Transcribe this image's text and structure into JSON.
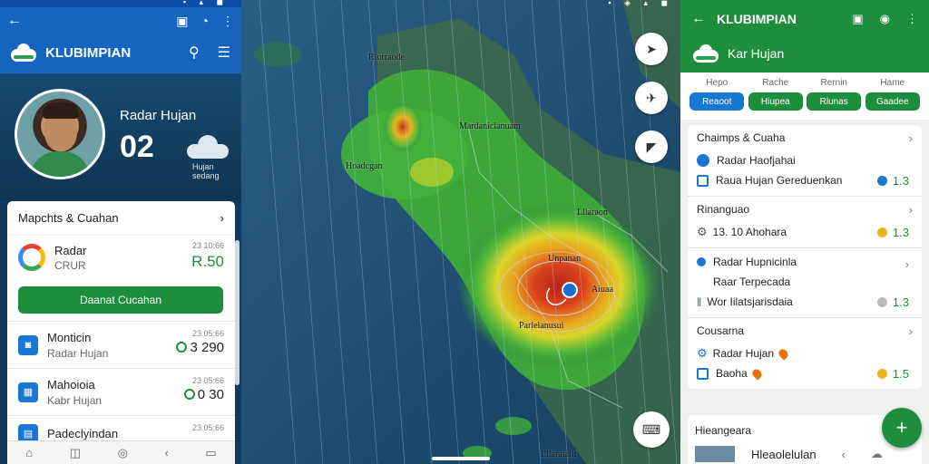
{
  "left": {
    "appbar_title": "KLUBIMPIAN",
    "hero": {
      "title": "Radar Hujan",
      "temperature": "02",
      "caption": "Hujan sedang"
    },
    "card": {
      "header": "Mapchts & Cuahan",
      "google_item": {
        "title": "Radar",
        "subtitle": "CRUR",
        "right_top": "23 10:66",
        "right_value": "R.50"
      },
      "button_label": "Daanat Cucahan",
      "list": [
        {
          "title": "Monticin",
          "subtitle": "Radar Hujan",
          "right_top": "23 05:66",
          "right_value": "3 290"
        },
        {
          "title": "Mahoioia",
          "subtitle": "Kabr Hujan",
          "right_top": "23 05:66",
          "right_value": "0 30"
        },
        {
          "title": "Padeclyindan",
          "subtitle": "",
          "right_top": "23 05:66",
          "right_value": ""
        }
      ]
    }
  },
  "map": {
    "labels": [
      "Rlorraode",
      "Mardaniclanuam",
      "Hoadcgan",
      "Lllaraon",
      "Unpanan",
      "Aiuaa",
      "Parlelanusui",
      "Lllaraiatlt"
    ]
  },
  "right": {
    "appbar_title": "KLUBIMPIAN",
    "subtitle": "Kar Hujan",
    "tabs": [
      {
        "label": "Hepo",
        "pill": "Reaoot",
        "active": true
      },
      {
        "label": "Rache",
        "pill": "Hiupea",
        "active": false
      },
      {
        "label": "Rernin",
        "pill": "Rlunas",
        "active": false
      },
      {
        "label": "Hame",
        "pill": "Gaadee",
        "active": false
      }
    ],
    "sections": [
      {
        "header": "Chaimps & Cuaha",
        "items": [
          {
            "icon": "pin",
            "text": "Radar Haofjahai",
            "value": ""
          },
          {
            "icon": "square",
            "text": "Raua Hujan Gereduenkan",
            "value": "1.3"
          }
        ]
      },
      {
        "header": "Rinanguao",
        "items": [
          {
            "icon": "gear",
            "text": "13. 10 Ahohara",
            "value": "1.3"
          }
        ]
      },
      {
        "header": "",
        "items": [
          {
            "icon": "pin",
            "text": "Radar Hupnicinla",
            "value": ""
          },
          {
            "icon": "none",
            "text": "Raar Terpecada",
            "value": ""
          },
          {
            "icon": "bars",
            "text": "Wor Iilatsjarisdaia",
            "value": "1.3"
          }
        ]
      },
      {
        "header": "Cousarna",
        "items": [
          {
            "icon": "gear",
            "text": "Radar Hujan",
            "value": ""
          },
          {
            "icon": "square",
            "text": "Baoha",
            "value": "1.5"
          }
        ]
      }
    ],
    "bottom": {
      "header": "Hieangeara",
      "item": "Hleaolelulan"
    }
  }
}
